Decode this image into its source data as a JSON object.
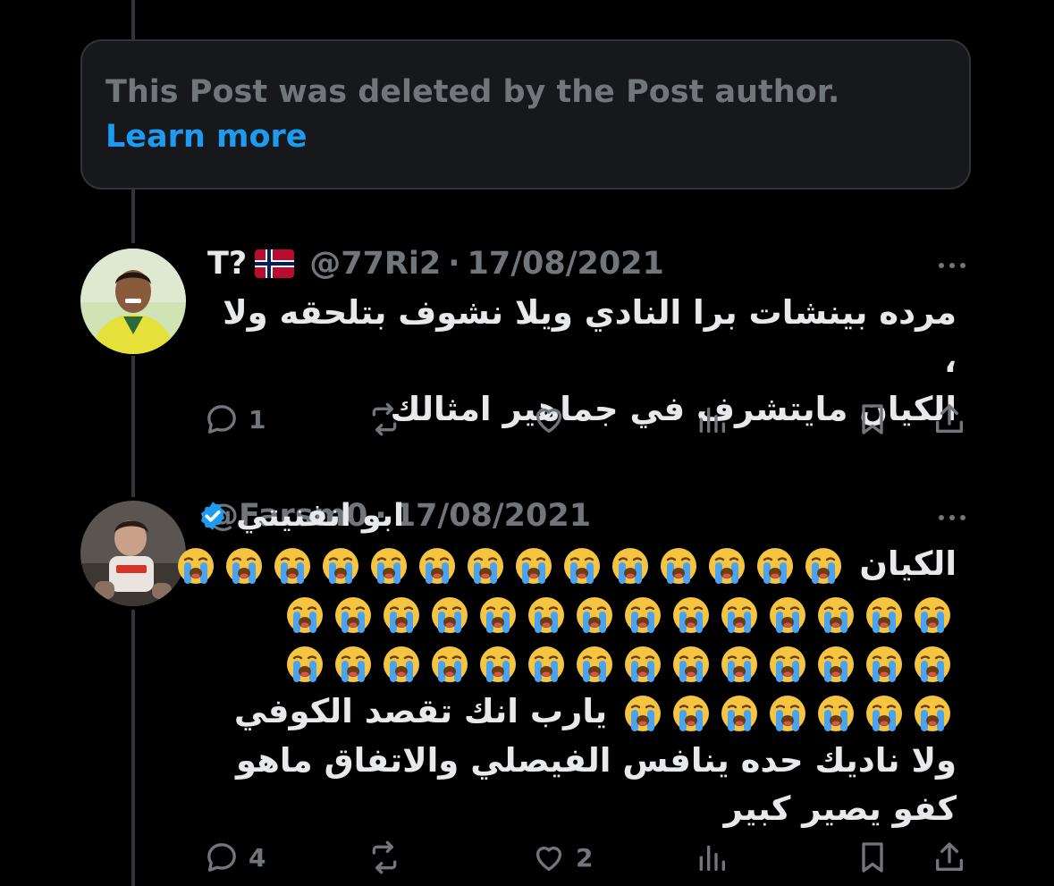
{
  "deleted_notice": {
    "text": "This Post was deleted by the Post author.",
    "link_text": "Learn more",
    "link_color": "#1d9bf0"
  },
  "posts": [
    {
      "display_name": "T?",
      "flag": "🇳🇴",
      "handle": "@77Ri2",
      "date": "17/08/2021",
      "text_lines": [
        "مرده بينشات برا النادي ويلا نشوف بتلحقه ولا ،",
        "الكيان مايتشرف في جماهير امثالك"
      ],
      "actions": {
        "reply_count": "1",
        "repost_count": "",
        "like_count": "",
        "views_count": ""
      }
    },
    {
      "display_name": "ابو انفنيتي",
      "verified": true,
      "handle": "@Farsm0",
      "date": "17/08/2021",
      "first_word": "الكيان",
      "emoji": "😭",
      "text_after_emojis": "يارب انك تقصد الكوفي",
      "text_lines": [
        "ولا ناديك حده ينافس الفيصلي والاتفاق ماهو",
        "كفو يصير كبير"
      ],
      "actions": {
        "reply_count": "4",
        "repost_count": "",
        "like_count": "2",
        "views_count": ""
      }
    }
  ],
  "colors": {
    "background": "#000000",
    "text_primary": "#e7e9ea",
    "text_secondary": "#71767b",
    "verified": "#1d9bf0",
    "box_bg": "#16181c",
    "border": "#2f3336"
  }
}
